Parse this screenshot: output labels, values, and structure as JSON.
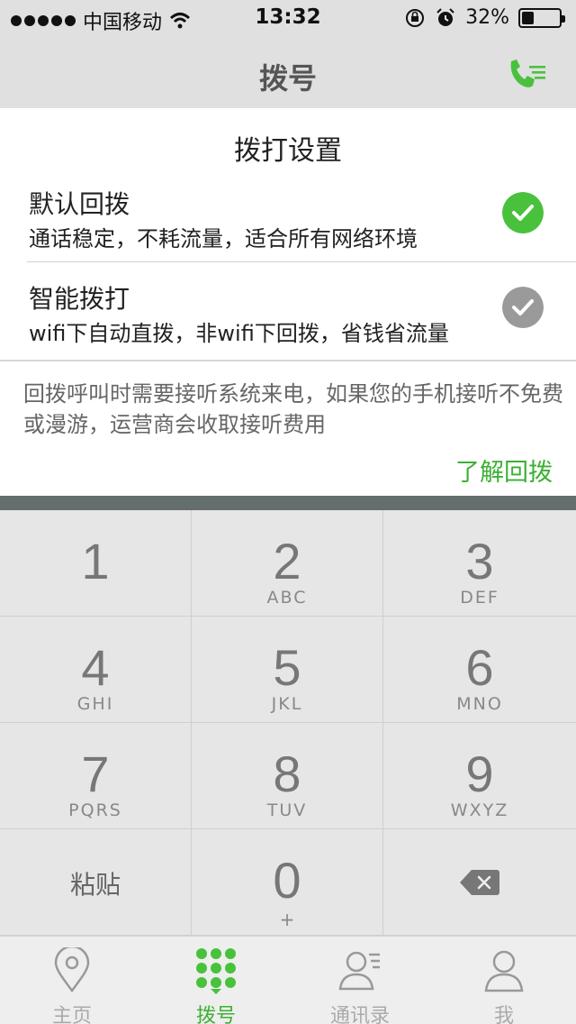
{
  "status_bar": {
    "carrier": "中国移动",
    "time": "13:32",
    "battery": "32%",
    "battery_level": 0.32
  },
  "nav": {
    "title": "拨号",
    "menu_icon": "phone-list-icon"
  },
  "dial_settings": {
    "title": "拨打设置",
    "options": [
      {
        "title": "默认回拨",
        "desc": "通话稳定，不耗流量，适合所有网络环境",
        "selected": true
      },
      {
        "title": "智能拨打",
        "desc": "wifi下自动直拨，非wifi下回拨，省钱省流量",
        "selected": false
      }
    ],
    "notice": "回拨呼叫时需要接听系统来电，如果您的手机接听不免费或漫游，运营商会收取接听费用",
    "learn_link": "了解回拨"
  },
  "keypad": {
    "keys": [
      {
        "digit": "1",
        "letters": ""
      },
      {
        "digit": "2",
        "letters": "ABC"
      },
      {
        "digit": "3",
        "letters": "DEF"
      },
      {
        "digit": "4",
        "letters": "GHI"
      },
      {
        "digit": "5",
        "letters": "JKL"
      },
      {
        "digit": "6",
        "letters": "MNO"
      },
      {
        "digit": "7",
        "letters": "PQRS"
      },
      {
        "digit": "8",
        "letters": "TUV"
      },
      {
        "digit": "9",
        "letters": "WXYZ"
      }
    ],
    "paste": "粘贴",
    "zero": {
      "digit": "0",
      "letters": "+"
    },
    "delete_icon": "backspace-icon"
  },
  "tabs": [
    {
      "label": "主页",
      "icon": "location-pin-icon",
      "active": false
    },
    {
      "label": "拨号",
      "icon": "dialpad-icon",
      "active": true
    },
    {
      "label": "通讯录",
      "icon": "contacts-icon",
      "active": false
    },
    {
      "label": "我",
      "icon": "person-icon",
      "active": false
    }
  ],
  "colors": {
    "accent": "#3cb034",
    "selected_check": "#49c13d",
    "unselected_check": "#9a9a9a"
  }
}
